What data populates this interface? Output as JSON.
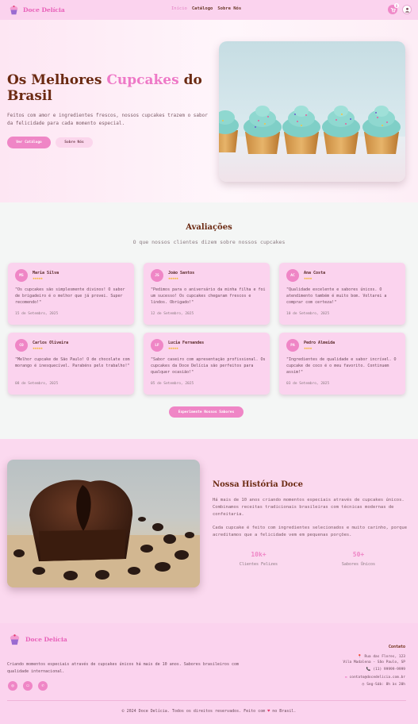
{
  "nav": {
    "brand": "Doce Delícia",
    "links": [
      "Início",
      "Catálogo",
      "Sobre Nós"
    ],
    "cart_count": "0"
  },
  "hero": {
    "title_part1": "Os Melhores ",
    "title_highlight": "Cupcakes",
    "title_part2": " do Brasil",
    "subtitle": "Feitos com amor e ingredientes frescos, nossos cupcakes trazem o sabor da felicidade para cada momento especial.",
    "primary_cta": "Ver Catálogo",
    "secondary_cta": "Sobre Nós"
  },
  "reviews": {
    "title": "Avaliações",
    "subtitle": "O que nossos clientes dizem sobre nossos cupcakes",
    "items": [
      {
        "initials": "MS",
        "name": "Maria Silva",
        "stars": "★★★★★",
        "text": "\"Os cupcakes são simplesmente divinos! O sabor de brigadeiro é o melhor que já provei. Super recomendo!\"",
        "date": "15 de Setembro, 2025"
      },
      {
        "initials": "JS",
        "name": "João Santos",
        "stars": "★★★★★",
        "text": "\"Pedimos para o aniversário da minha filha e foi um sucesso! Os cupcakes chegaram frescos e lindos. Obrigado!\"",
        "date": "12 de Setembro, 2025"
      },
      {
        "initials": "AC",
        "name": "Ana Costa",
        "stars": "★★★★",
        "text": "\"Qualidade excelente e sabores únicos. O atendimento também é muito bom. Voltarei a comprar com certeza!\"",
        "date": "10 de Setembro, 2025"
      },
      {
        "initials": "CO",
        "name": "Carlos Oliveira",
        "stars": "★★★★★",
        "text": "\"Melhor cupcake de São Paulo! O de chocolate com morango é inesquecível. Parabéns pelo trabalho!\"",
        "date": "08 de Setembro, 2025"
      },
      {
        "initials": "LF",
        "name": "Lucia Fernandes",
        "stars": "★★★★★",
        "text": "\"Sabor caseiro com apresentação profissional. Os cupcakes da Doce Delícia são perfeitos para qualquer ocasião!\"",
        "date": "05 de Setembro, 2025"
      },
      {
        "initials": "PA",
        "name": "Pedro Almeida",
        "stars": "★★★★",
        "text": "\"Ingredientes de qualidade e sabor incrível. O cupcake de coco é o meu favorito. Continuem assim!\"",
        "date": "03 de Setembro, 2025"
      }
    ],
    "cta": "Experimente Nossos Sabores"
  },
  "story": {
    "title": "Nossa História Doce",
    "p1": "Há mais de 10 anos criando momentos especiais através de cupcakes únicos. Combinamos receitas tradicionais brasileiras com técnicas modernas de confeitaria.",
    "p2": "Cada cupcake é feito com ingredientes selecionados e muito carinho, porque acreditamos que a felicidade vem em pequenas porções.",
    "stats": [
      {
        "value": "10k+",
        "label": "Clientes Felizes"
      },
      {
        "value": "50+",
        "label": "Sabores Únicos"
      }
    ]
  },
  "footer": {
    "brand": "Doce Delícia",
    "description": "Criando momentos especiais através de cupcakes únicos há mais de 10 anos. Sabores brasileiros com qualidade internacional.",
    "contact_title": "Contato",
    "address_line1": "Rua das Flores, 123",
    "address_line2": "Vila Madalena - São Paulo, SP",
    "phone": "(11) 99999-9999",
    "email": "contato@docedelicia.com.br",
    "hours": "Seg-Sáb: 8h às 20h",
    "copyright_prefix": "© 2024 Doce Delícia. Todos os direitos reservados. Feito com",
    "copyright_suffix": "no Brasil."
  },
  "colors": {
    "accent": "#ef86c6",
    "brand_dark": "#6b2a12",
    "nav_bg": "#fbd3ee",
    "star": "#f2b416"
  },
  "icons": [
    "cupcake-logo-icon",
    "cart-icon",
    "user-icon",
    "instagram-icon",
    "facebook-icon",
    "whatsapp-icon",
    "location-icon",
    "phone-icon",
    "email-icon",
    "clock-icon",
    "heart-icon"
  ]
}
